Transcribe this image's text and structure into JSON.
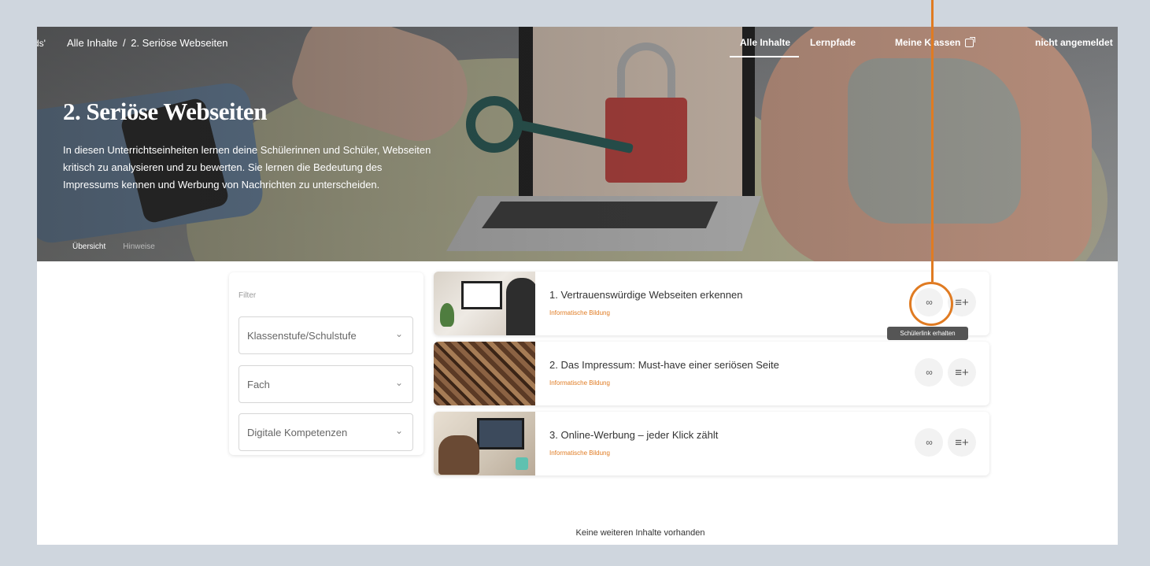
{
  "topbar": {
    "crumb_lead": "ds'",
    "breadcrumb_home": "Alle Inhalte",
    "breadcrumb_sep": "/",
    "breadcrumb_current": "2. Seriöse Webseiten",
    "nav_all": "Alle Inhalte",
    "nav_paths": "Lernpfade",
    "nav_classes": "Meine Klassen",
    "nav_login": "nicht angemeldet"
  },
  "hero": {
    "title": "2. Seriöse Webseiten",
    "description": "In diesen Unterrichtseinheiten lernen deine Schülerinnen und Schüler, Webseiten kritisch zu analysieren und zu bewerten. Sie lernen die Bedeutung des Impressums kennen und Werbung von Nachrichten zu unterscheiden.",
    "tab_overview": "Übersicht",
    "tab_other": "Hinweise"
  },
  "filter": {
    "title": "Filter",
    "grade": "Klassenstufe/Schulstufe",
    "subject": "Fach",
    "skills": "Digitale Kompetenzen"
  },
  "cards": [
    {
      "title": "1. Vertrauenswürdige Webseiten erkennen",
      "subtitle": "Informatische Bildung"
    },
    {
      "title": "2. Das Impressum: Must-have einer seriösen Seite",
      "subtitle": "Informatische Bildung"
    },
    {
      "title": "3. Online-Werbung – jeder Klick zählt",
      "subtitle": "Informatische Bildung"
    }
  ],
  "icons": {
    "share": "∞",
    "queue": "≡+",
    "caret": "⌄"
  },
  "tooltip": "Schülerlink erhalten",
  "footer_note": "Keine weiteren Inhalte vorhanden",
  "colors": {
    "accent": "#e07b22",
    "page_bg": "#cfd6de"
  }
}
